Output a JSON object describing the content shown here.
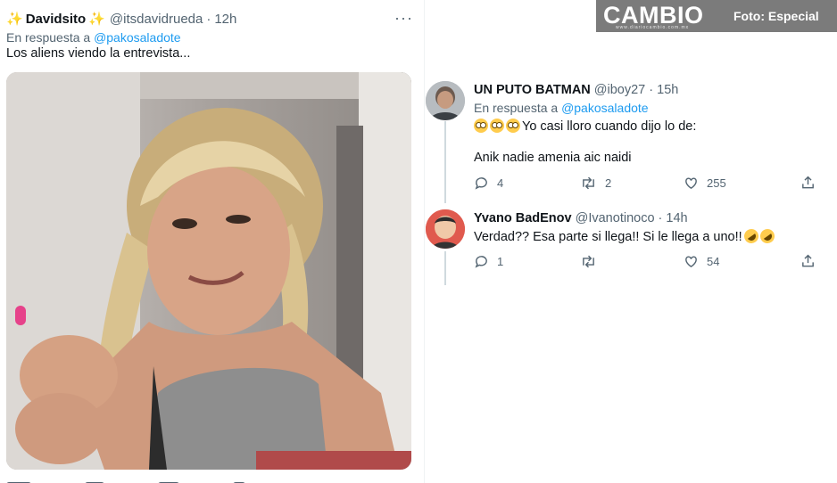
{
  "left_tweet": {
    "sparkle_left": "✨",
    "display_name": "Davidsito",
    "sparkle_right": "✨",
    "handle": "@itsdavidrueda",
    "separator": "·",
    "time": "12h",
    "more": "···",
    "reply_prefix": "En respuesta a",
    "reply_to": "@pakosaladote",
    "text": "Los aliens viendo la entrevista..."
  },
  "watermark": {
    "logo": "CAMBIO",
    "sub": "www.diariocambio.com.mx",
    "credit": "Foto: Especial"
  },
  "replies": [
    {
      "display_name": "UN PUTO BATMAN",
      "handle": "@iboy27",
      "separator": "·",
      "time": "15h",
      "reply_prefix": "En respuesta a",
      "reply_to": "@pakosaladote",
      "text_line1": "Yo casi lloro cuando dijo lo de:",
      "text_line2": "Anik nadie amenia aic naidi",
      "replies_count": "4",
      "retweets_count": "2",
      "likes_count": "255"
    },
    {
      "display_name": "Yvano BadEnov",
      "handle": "@Ivanotinoco",
      "separator": "·",
      "time": "14h",
      "text_line1": "Verdad?? Esa parte si llega!! Si le llega a uno!!",
      "replies_count": "1",
      "retweets_count": "",
      "likes_count": "54"
    }
  ],
  "icons": {
    "reply": "reply-icon",
    "retweet": "retweet-icon",
    "like": "heart-icon",
    "share": "share-icon"
  },
  "colors": {
    "link": "#1d9bf0",
    "muted": "#536471",
    "watermark_bg": "#7b7b7b"
  }
}
